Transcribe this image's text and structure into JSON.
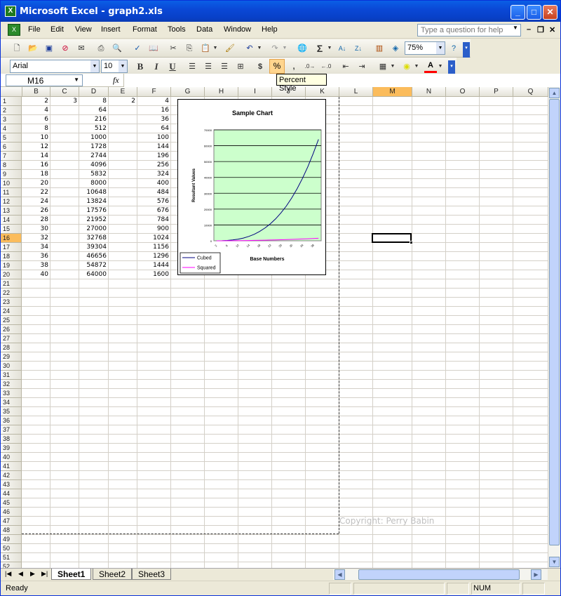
{
  "window": {
    "title": "Microsoft Excel - graph2.xls",
    "minimize": "_",
    "maximize": "□",
    "close": "✕"
  },
  "menu": [
    "File",
    "Edit",
    "View",
    "Insert",
    "Format",
    "Tools",
    "Data",
    "Window",
    "Help"
  ],
  "ask_placeholder": "Type a question for help",
  "toolbar": {
    "zoom": "75%",
    "font": "Arial",
    "size": "10"
  },
  "tooltip": "Percent Style",
  "namebox": "M16",
  "columns": [
    "B",
    "C",
    "D",
    "E",
    "F",
    "G",
    "H",
    "I",
    "J",
    "K",
    "L",
    "M",
    "N",
    "O",
    "P",
    "Q"
  ],
  "selected_column": "M",
  "selected_row": 16,
  "rows_visible": 52,
  "cells": {
    "B": [
      "2",
      "4",
      "6",
      "8",
      "10",
      "12",
      "14",
      "16",
      "18",
      "20",
      "22",
      "24",
      "26",
      "28",
      "30",
      "32",
      "34",
      "36",
      "38",
      "40"
    ],
    "C": [
      "3"
    ],
    "D": [
      "8",
      "64",
      "216",
      "512",
      "1000",
      "1728",
      "2744",
      "4096",
      "5832",
      "8000",
      "10648",
      "13824",
      "17576",
      "21952",
      "27000",
      "32768",
      "39304",
      "46656",
      "54872",
      "64000"
    ],
    "E": [
      "2"
    ],
    "F": [
      "4",
      "16",
      "36",
      "64",
      "100",
      "144",
      "196",
      "256",
      "324",
      "400",
      "484",
      "576",
      "676",
      "784",
      "900",
      "1024",
      "1156",
      "1296",
      "1444",
      "1600"
    ]
  },
  "chart_data": {
    "type": "line",
    "title": "Sample Chart",
    "xlabel": "Base Numbers",
    "ylabel": "Resultant Values",
    "ylim": [
      0,
      70000
    ],
    "y_ticks": [
      "0",
      "10000",
      "20000",
      "30000",
      "40000",
      "50000",
      "60000",
      "70000"
    ],
    "x": [
      2,
      4,
      6,
      8,
      10,
      12,
      14,
      16,
      18,
      20,
      22,
      24,
      26,
      28,
      30,
      32,
      34,
      36,
      38,
      40
    ],
    "series": [
      {
        "name": "Cubed",
        "color": "#000080",
        "values": [
          8,
          64,
          216,
          512,
          1000,
          1728,
          2744,
          4096,
          5832,
          8000,
          10648,
          13824,
          17576,
          21952,
          27000,
          32768,
          39304,
          46656,
          54872,
          64000
        ]
      },
      {
        "name": "Squared",
        "color": "#ff00ff",
        "values": [
          4,
          16,
          36,
          64,
          100,
          144,
          196,
          256,
          324,
          400,
          484,
          576,
          676,
          784,
          900,
          1024,
          1156,
          1296,
          1444,
          1600
        ]
      }
    ],
    "plot_bg": "#ccffcc",
    "grid": true,
    "legend_position": "bottom-left"
  },
  "copyright": "Copyright: Perry Babin",
  "sheets": [
    "Sheet1",
    "Sheet2",
    "Sheet3"
  ],
  "active_sheet": "Sheet1",
  "status": {
    "left": "Ready",
    "num": "NUM"
  }
}
